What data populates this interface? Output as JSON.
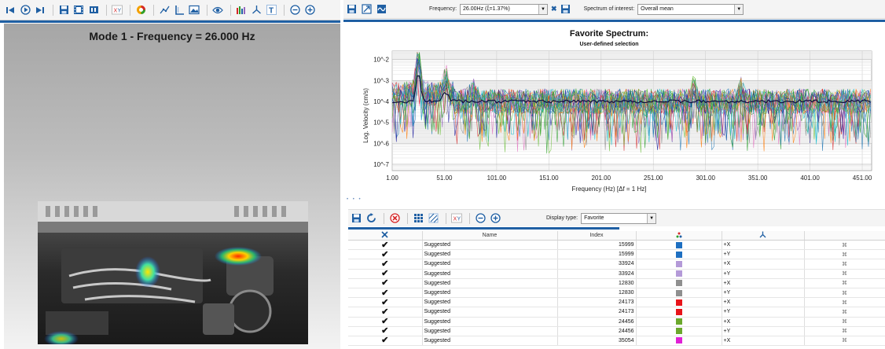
{
  "left_panel": {
    "mode_title": "Mode 1 - Frequency = 26.000 Hz"
  },
  "right_toolbar": {
    "frequency_label": "Frequency:",
    "frequency_value": "26.00Hz (ξ=1.37%)",
    "spectrum_label": "Spectrum of interest:",
    "spectrum_value": "Overall mean"
  },
  "chart_data": {
    "type": "line",
    "title": "Favorite Spectrum:",
    "subtitle": "User-defined selection",
    "xlabel": "Frequency (Hz) [Δf = 1 Hz]",
    "ylabel": "Log. Velocity (cm/s)",
    "y_scale": "log",
    "xlim": [
      1,
      460
    ],
    "ylim_exponents": [
      -7.3,
      -1.6
    ],
    "x_ticks": [
      "1.00",
      "51.00",
      "101.00",
      "151.00",
      "201.00",
      "251.00",
      "301.00",
      "351.00",
      "401.00",
      "451.00"
    ],
    "x_tick_values": [
      1,
      51,
      101,
      151,
      201,
      251,
      301,
      351,
      401,
      451
    ],
    "y_ticks": [
      "10^-2",
      "10^-3",
      "10^-4",
      "10^-5",
      "10^-6",
      "10^-7"
    ],
    "y_tick_exponents": [
      -2,
      -3,
      -4,
      -5,
      -6,
      -7
    ],
    "grid": true,
    "series_colors": [
      "#1f77b4",
      "#2ca02c",
      "#9467bd",
      "#8c8c8c",
      "#d62728",
      "#ff7f0e",
      "#e377c2",
      "#17becf",
      "#1a1a9c",
      "#6bbf3a"
    ],
    "mean_series_color": "#101040",
    "description_of_series": "Many overlapping noisy velocity spectra with peak near 26 Hz at about 10^-2"
  },
  "grid_toolbar": {
    "display_type_label": "Display type:",
    "display_type_value": "Favorite"
  },
  "table": {
    "columns": [
      "",
      "Name",
      "Index",
      "",
      "",
      ""
    ],
    "rows": [
      {
        "name": "Suggested",
        "index": "15999",
        "color": "#1e6fc1",
        "dir": "+X"
      },
      {
        "name": "Suggested",
        "index": "15999",
        "color": "#1e6fc1",
        "dir": "+Y"
      },
      {
        "name": "Suggested",
        "index": "33924",
        "color": "#b49ad8",
        "dir": "+X"
      },
      {
        "name": "Suggested",
        "index": "33924",
        "color": "#b49ad8",
        "dir": "+Y"
      },
      {
        "name": "Suggested",
        "index": "12830",
        "color": "#8f8f8f",
        "dir": "+X"
      },
      {
        "name": "Suggested",
        "index": "12830",
        "color": "#8f8f8f",
        "dir": "+Y"
      },
      {
        "name": "Suggested",
        "index": "24173",
        "color": "#e8141a",
        "dir": "+X"
      },
      {
        "name": "Suggested",
        "index": "24173",
        "color": "#e8141a",
        "dir": "+Y"
      },
      {
        "name": "Suggested",
        "index": "24456",
        "color": "#6ba82c",
        "dir": "+X"
      },
      {
        "name": "Suggested",
        "index": "24456",
        "color": "#6ba82c",
        "dir": "+Y"
      },
      {
        "name": "Suggested",
        "index": "35054",
        "color": "#e020d6",
        "dir": "+X"
      }
    ]
  },
  "colors": {
    "accent_blue": "#1f5fa3",
    "toolbar_bg": "#f4f4f4"
  }
}
